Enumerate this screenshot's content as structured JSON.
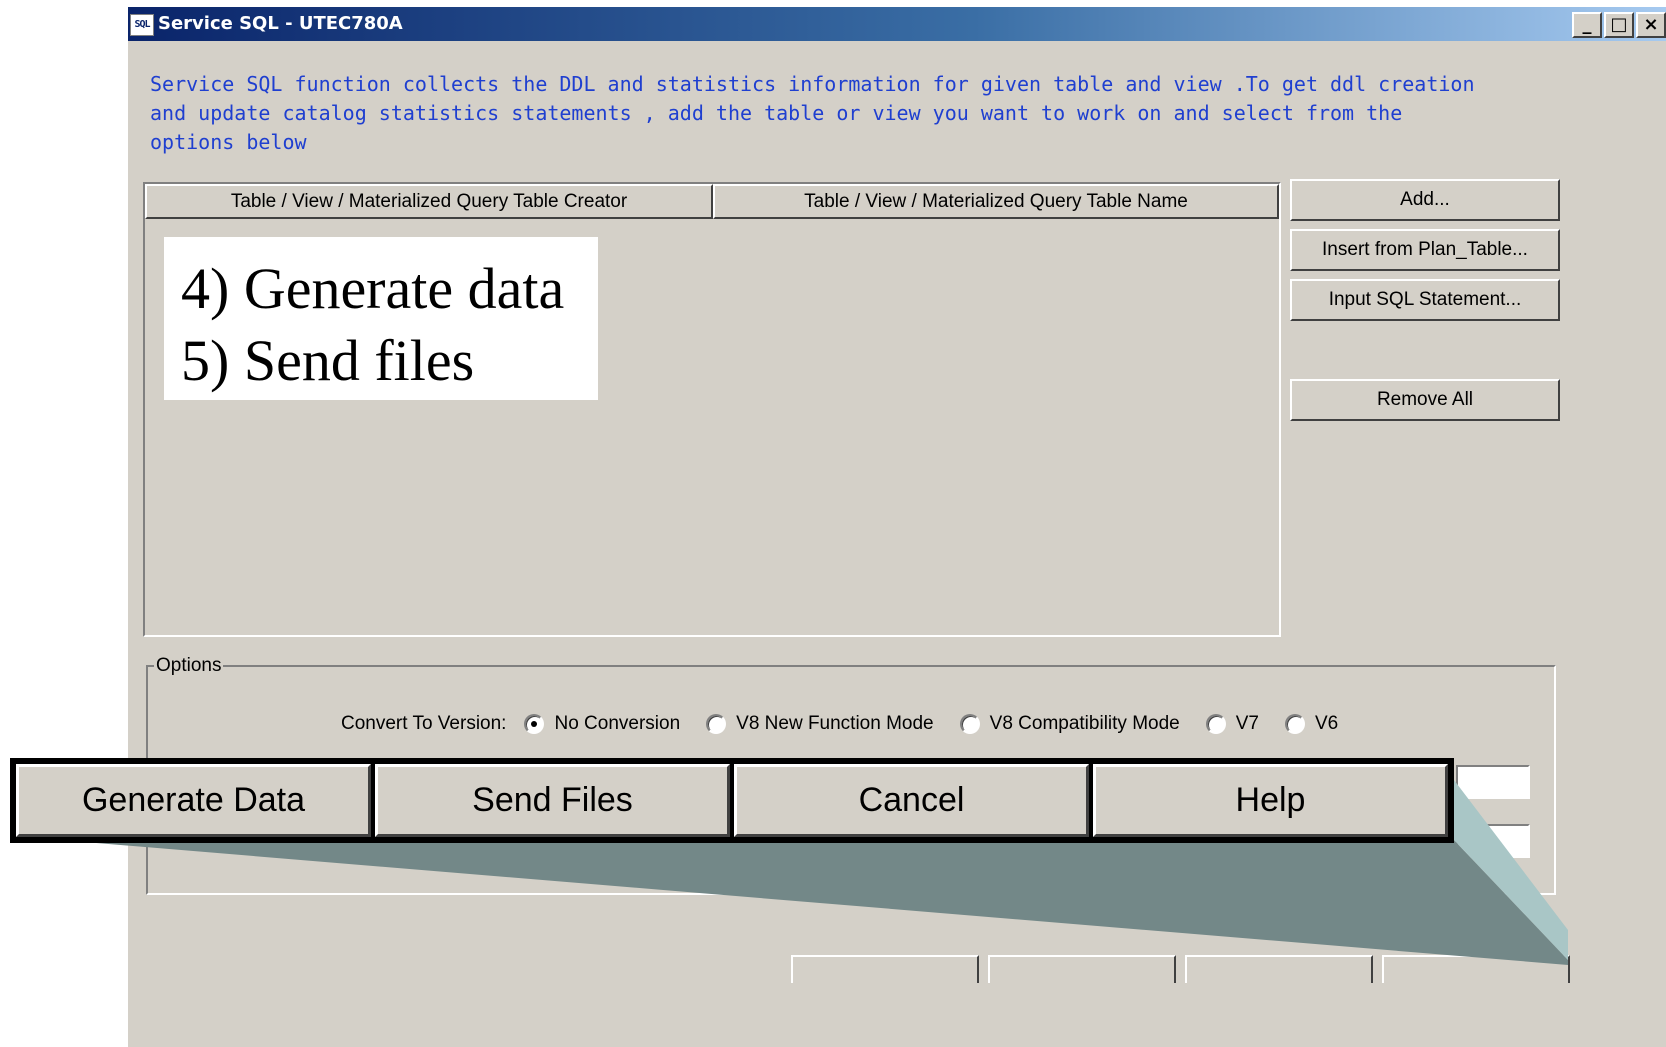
{
  "window": {
    "icon_text": "SQL",
    "title": "Service SQL - UTEC780A",
    "controls": {
      "minimize": "_",
      "maximize": "□",
      "close": "×"
    }
  },
  "description": "Service SQL function collects the DDL and statistics information for given table and view .To get ddl creation\nand update catalog statistics statements , add the table or view you want to work on and select from the\noptions below",
  "table": {
    "columns": [
      "Table / View / Materialized Query Table Creator",
      "Table / View / Materialized Query Table Name"
    ]
  },
  "side_buttons": {
    "add": "Add...",
    "insert_plan_table": "Insert from Plan_Table...",
    "input_sql": "Input SQL Statement...",
    "remove_all": "Remove All"
  },
  "options": {
    "legend": "Options",
    "convert_label": "Convert To Version:",
    "selected": "No Conversion",
    "versions": [
      "No Conversion",
      "V8 New Function Mode",
      "V8 Compatibility Mode",
      "V7",
      "V6"
    ]
  },
  "callout": {
    "line1": "4) Generate data",
    "line2": "5) Send files"
  },
  "zoomed_buttons": {
    "generate": "Generate Data",
    "send": "Send Files",
    "cancel": "Cancel",
    "help": "Help"
  },
  "colors": {
    "dialog_bg": "#d4d0c8",
    "title_gradient_start": "#0a246a",
    "description_text": "#1f3fd0",
    "callout_wedge": "#738888",
    "callout_wedge_edge": "#a9c6c6"
  }
}
